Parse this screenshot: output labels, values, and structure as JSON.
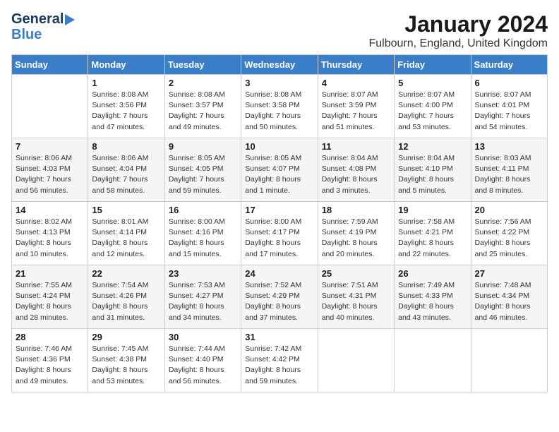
{
  "logo": {
    "line1": "General",
    "line2": "Blue"
  },
  "title": "January 2024",
  "subtitle": "Fulbourn, England, United Kingdom",
  "calendar": {
    "headers": [
      "Sunday",
      "Monday",
      "Tuesday",
      "Wednesday",
      "Thursday",
      "Friday",
      "Saturday"
    ],
    "weeks": [
      [
        {
          "day": "",
          "sunrise": "",
          "sunset": "",
          "daylight": ""
        },
        {
          "day": "1",
          "sunrise": "Sunrise: 8:08 AM",
          "sunset": "Sunset: 3:56 PM",
          "daylight": "Daylight: 7 hours and 47 minutes."
        },
        {
          "day": "2",
          "sunrise": "Sunrise: 8:08 AM",
          "sunset": "Sunset: 3:57 PM",
          "daylight": "Daylight: 7 hours and 49 minutes."
        },
        {
          "day": "3",
          "sunrise": "Sunrise: 8:08 AM",
          "sunset": "Sunset: 3:58 PM",
          "daylight": "Daylight: 7 hours and 50 minutes."
        },
        {
          "day": "4",
          "sunrise": "Sunrise: 8:07 AM",
          "sunset": "Sunset: 3:59 PM",
          "daylight": "Daylight: 7 hours and 51 minutes."
        },
        {
          "day": "5",
          "sunrise": "Sunrise: 8:07 AM",
          "sunset": "Sunset: 4:00 PM",
          "daylight": "Daylight: 7 hours and 53 minutes."
        },
        {
          "day": "6",
          "sunrise": "Sunrise: 8:07 AM",
          "sunset": "Sunset: 4:01 PM",
          "daylight": "Daylight: 7 hours and 54 minutes."
        }
      ],
      [
        {
          "day": "7",
          "sunrise": "Sunrise: 8:06 AM",
          "sunset": "Sunset: 4:03 PM",
          "daylight": "Daylight: 7 hours and 56 minutes."
        },
        {
          "day": "8",
          "sunrise": "Sunrise: 8:06 AM",
          "sunset": "Sunset: 4:04 PM",
          "daylight": "Daylight: 7 hours and 58 minutes."
        },
        {
          "day": "9",
          "sunrise": "Sunrise: 8:05 AM",
          "sunset": "Sunset: 4:05 PM",
          "daylight": "Daylight: 7 hours and 59 minutes."
        },
        {
          "day": "10",
          "sunrise": "Sunrise: 8:05 AM",
          "sunset": "Sunset: 4:07 PM",
          "daylight": "Daylight: 8 hours and 1 minute."
        },
        {
          "day": "11",
          "sunrise": "Sunrise: 8:04 AM",
          "sunset": "Sunset: 4:08 PM",
          "daylight": "Daylight: 8 hours and 3 minutes."
        },
        {
          "day": "12",
          "sunrise": "Sunrise: 8:04 AM",
          "sunset": "Sunset: 4:10 PM",
          "daylight": "Daylight: 8 hours and 5 minutes."
        },
        {
          "day": "13",
          "sunrise": "Sunrise: 8:03 AM",
          "sunset": "Sunset: 4:11 PM",
          "daylight": "Daylight: 8 hours and 8 minutes."
        }
      ],
      [
        {
          "day": "14",
          "sunrise": "Sunrise: 8:02 AM",
          "sunset": "Sunset: 4:13 PM",
          "daylight": "Daylight: 8 hours and 10 minutes."
        },
        {
          "day": "15",
          "sunrise": "Sunrise: 8:01 AM",
          "sunset": "Sunset: 4:14 PM",
          "daylight": "Daylight: 8 hours and 12 minutes."
        },
        {
          "day": "16",
          "sunrise": "Sunrise: 8:00 AM",
          "sunset": "Sunset: 4:16 PM",
          "daylight": "Daylight: 8 hours and 15 minutes."
        },
        {
          "day": "17",
          "sunrise": "Sunrise: 8:00 AM",
          "sunset": "Sunset: 4:17 PM",
          "daylight": "Daylight: 8 hours and 17 minutes."
        },
        {
          "day": "18",
          "sunrise": "Sunrise: 7:59 AM",
          "sunset": "Sunset: 4:19 PM",
          "daylight": "Daylight: 8 hours and 20 minutes."
        },
        {
          "day": "19",
          "sunrise": "Sunrise: 7:58 AM",
          "sunset": "Sunset: 4:21 PM",
          "daylight": "Daylight: 8 hours and 22 minutes."
        },
        {
          "day": "20",
          "sunrise": "Sunrise: 7:56 AM",
          "sunset": "Sunset: 4:22 PM",
          "daylight": "Daylight: 8 hours and 25 minutes."
        }
      ],
      [
        {
          "day": "21",
          "sunrise": "Sunrise: 7:55 AM",
          "sunset": "Sunset: 4:24 PM",
          "daylight": "Daylight: 8 hours and 28 minutes."
        },
        {
          "day": "22",
          "sunrise": "Sunrise: 7:54 AM",
          "sunset": "Sunset: 4:26 PM",
          "daylight": "Daylight: 8 hours and 31 minutes."
        },
        {
          "day": "23",
          "sunrise": "Sunrise: 7:53 AM",
          "sunset": "Sunset: 4:27 PM",
          "daylight": "Daylight: 8 hours and 34 minutes."
        },
        {
          "day": "24",
          "sunrise": "Sunrise: 7:52 AM",
          "sunset": "Sunset: 4:29 PM",
          "daylight": "Daylight: 8 hours and 37 minutes."
        },
        {
          "day": "25",
          "sunrise": "Sunrise: 7:51 AM",
          "sunset": "Sunset: 4:31 PM",
          "daylight": "Daylight: 8 hours and 40 minutes."
        },
        {
          "day": "26",
          "sunrise": "Sunrise: 7:49 AM",
          "sunset": "Sunset: 4:33 PM",
          "daylight": "Daylight: 8 hours and 43 minutes."
        },
        {
          "day": "27",
          "sunrise": "Sunrise: 7:48 AM",
          "sunset": "Sunset: 4:34 PM",
          "daylight": "Daylight: 8 hours and 46 minutes."
        }
      ],
      [
        {
          "day": "28",
          "sunrise": "Sunrise: 7:46 AM",
          "sunset": "Sunset: 4:36 PM",
          "daylight": "Daylight: 8 hours and 49 minutes."
        },
        {
          "day": "29",
          "sunrise": "Sunrise: 7:45 AM",
          "sunset": "Sunset: 4:38 PM",
          "daylight": "Daylight: 8 hours and 53 minutes."
        },
        {
          "day": "30",
          "sunrise": "Sunrise: 7:44 AM",
          "sunset": "Sunset: 4:40 PM",
          "daylight": "Daylight: 8 hours and 56 minutes."
        },
        {
          "day": "31",
          "sunrise": "Sunrise: 7:42 AM",
          "sunset": "Sunset: 4:42 PM",
          "daylight": "Daylight: 8 hours and 59 minutes."
        },
        {
          "day": "",
          "sunrise": "",
          "sunset": "",
          "daylight": ""
        },
        {
          "day": "",
          "sunrise": "",
          "sunset": "",
          "daylight": ""
        },
        {
          "day": "",
          "sunrise": "",
          "sunset": "",
          "daylight": ""
        }
      ]
    ]
  }
}
